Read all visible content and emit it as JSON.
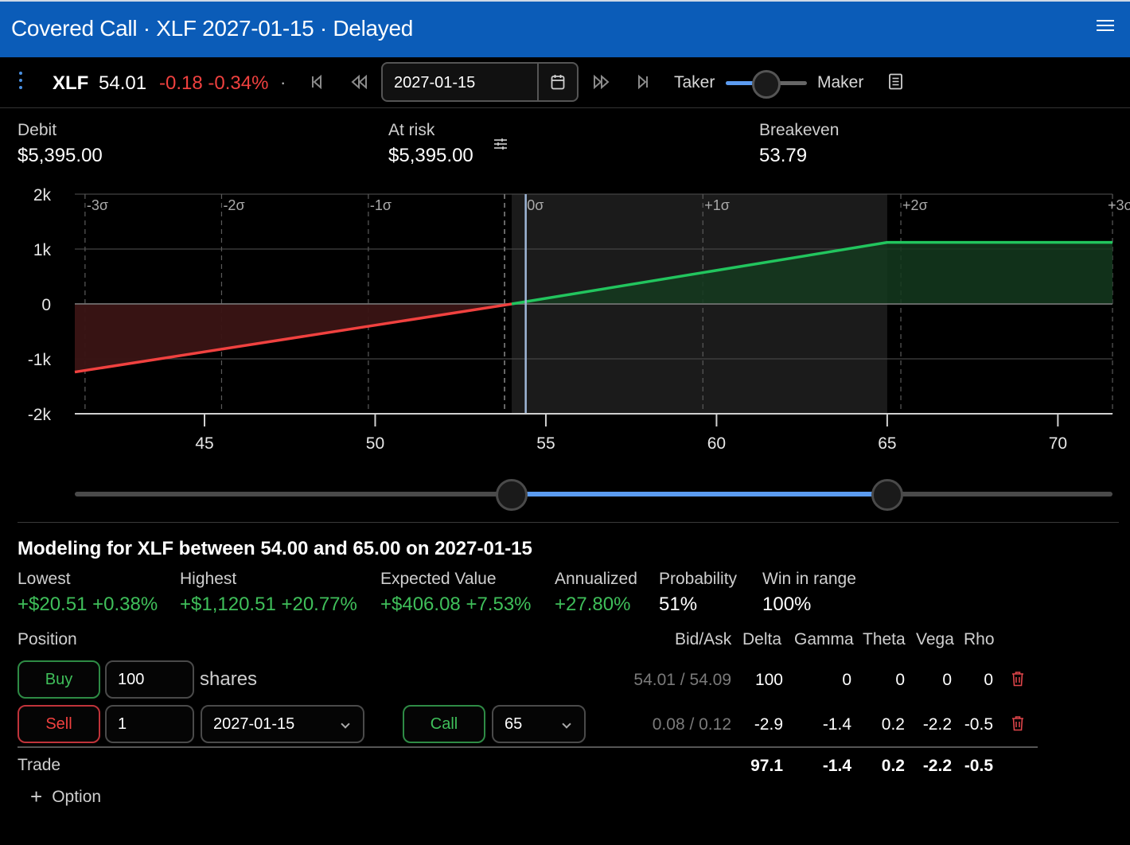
{
  "window": {
    "title": "Covered Call · XLF 2027-01-15 · Delayed"
  },
  "quote": {
    "symbol": "XLF",
    "price": "54.01",
    "change": "-0.18 -0.34%",
    "separator": "·"
  },
  "toolbar": {
    "date": "2027-01-15",
    "taker_label": "Taker",
    "maker_label": "Maker",
    "taker_maker_level": 0.5,
    "icons": [
      "more-vertical-icon",
      "skip-first-icon",
      "rewind-icon",
      "calendar-icon",
      "fast-forward-icon",
      "skip-last-icon",
      "document-icon"
    ]
  },
  "summary": {
    "debit_label": "Debit",
    "debit": "$5,395.00",
    "risk_label": "At risk",
    "risk": "$5,395.00",
    "breakeven_label": "Breakeven",
    "breakeven": "53.79"
  },
  "chart_data": {
    "type": "line",
    "x": [
      41.2,
      54.0,
      65.0,
      71.6
    ],
    "series": [
      {
        "values": [
          -1240,
          0,
          1120.51,
          1120.51
        ]
      }
    ],
    "xlim": [
      41.2,
      71.6
    ],
    "ylim": [
      -2000,
      2000
    ],
    "xticks": [
      "45",
      "50",
      "55",
      "60",
      "65",
      "70"
    ],
    "yticks": [
      "2k",
      "1k",
      "0",
      "-1k",
      "-2k"
    ],
    "sigma_labels": [
      "-3σ",
      "-2σ",
      "-1σ",
      "0σ",
      "+1σ",
      "+2σ",
      "+3σ"
    ],
    "sigma_x": [
      41.5,
      45.5,
      49.8,
      54.4,
      59.6,
      65.4,
      71.6
    ],
    "breakeven_x": 53.79,
    "current_price_x": 54.41,
    "range_start": 54.0,
    "range_end": 65.0,
    "loss_color": "#f0413f",
    "profit_color": "#22c55e",
    "grid": true
  },
  "range_slider": {
    "low": 54.0,
    "high": 65.0,
    "min": 41.2,
    "max": 71.6
  },
  "modeling": {
    "title": "Modeling for XLF between 54.00 and 65.00 on 2027-01-15",
    "stats": [
      {
        "label": "Lowest",
        "value": "+$20.51 +0.38%"
      },
      {
        "label": "Highest",
        "value": "+$1,120.51 +20.77%"
      },
      {
        "label": "Expected Value",
        "value": "+$406.08 +7.53%"
      },
      {
        "label": "Annualized",
        "value": "+27.80%"
      },
      {
        "label": "Probability",
        "value": "51%"
      },
      {
        "label": "Win in range",
        "value": "100%"
      }
    ]
  },
  "positions": {
    "headers": {
      "position": "Position",
      "bidask": "Bid/Ask",
      "delta": "Delta",
      "gamma": "Gamma",
      "theta": "Theta",
      "vega": "Vega",
      "rho": "Rho"
    },
    "rows": [
      {
        "side": "Buy",
        "qty": "100",
        "unit": "shares",
        "bidask": "54.01 / 54.09",
        "delta": "100",
        "gamma": "0",
        "theta": "0",
        "vega": "0",
        "rho": "0"
      },
      {
        "side": "Sell",
        "qty": "1",
        "expiry": "2027-01-15",
        "type": "Call",
        "strike": "65",
        "bidask": "0.08 / 0.12",
        "delta": "-2.9",
        "gamma": "-1.4",
        "theta": "0.2",
        "vega": "-2.2",
        "rho": "-0.5"
      }
    ],
    "trade": {
      "label": "Trade",
      "delta": "97.1",
      "gamma": "-1.4",
      "theta": "0.2",
      "vega": "-2.2",
      "rho": "-0.5"
    },
    "add_option_label": "Option"
  }
}
